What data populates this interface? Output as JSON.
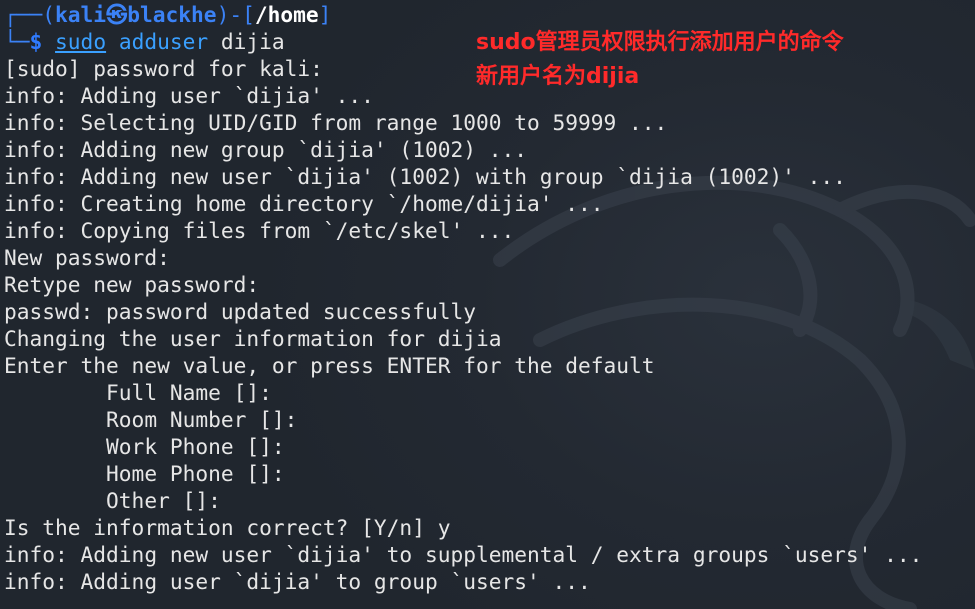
{
  "prompt": {
    "corner_top": "┌──(",
    "user": "kali",
    "at_icon": "㉿",
    "host": "blackhe",
    "mid": ")-[",
    "path": "/home",
    "end": "]",
    "corner_bottom": "└─",
    "dollar": "$",
    "cmd_sudo": "sudo",
    "cmd_adduser": "adduser",
    "cmd_arg": "dijia"
  },
  "output_lines": [
    "[sudo] password for kali:",
    "info: Adding user `dijia' ...",
    "info: Selecting UID/GID from range 1000 to 59999 ...",
    "info: Adding new group `dijia' (1002) ...",
    "info: Adding new user `dijia' (1002) with group `dijia (1002)' ...",
    "info: Creating home directory `/home/dijia' ...",
    "info: Copying files from `/etc/skel' ...",
    "New password:",
    "Retype new password:",
    "passwd: password updated successfully",
    "Changing the user information for dijia",
    "Enter the new value, or press ENTER for the default",
    "        Full Name []:",
    "        Room Number []:",
    "        Work Phone []:",
    "        Home Phone []:",
    "        Other []:",
    "Is the information correct? [Y/n] y",
    "info: Adding new user `dijia' to supplemental / extra groups `users' ...",
    "info: Adding user `dijia' to group `users' ..."
  ],
  "annotation": {
    "line1": "sudo管理员权限执行添加用户的命令",
    "line2": "新用户名为dijia",
    "color": "#ff2a2a"
  },
  "colors": {
    "background": "#222831",
    "prompt_blue": "#3b82f6",
    "text": "#e6e6e6"
  }
}
